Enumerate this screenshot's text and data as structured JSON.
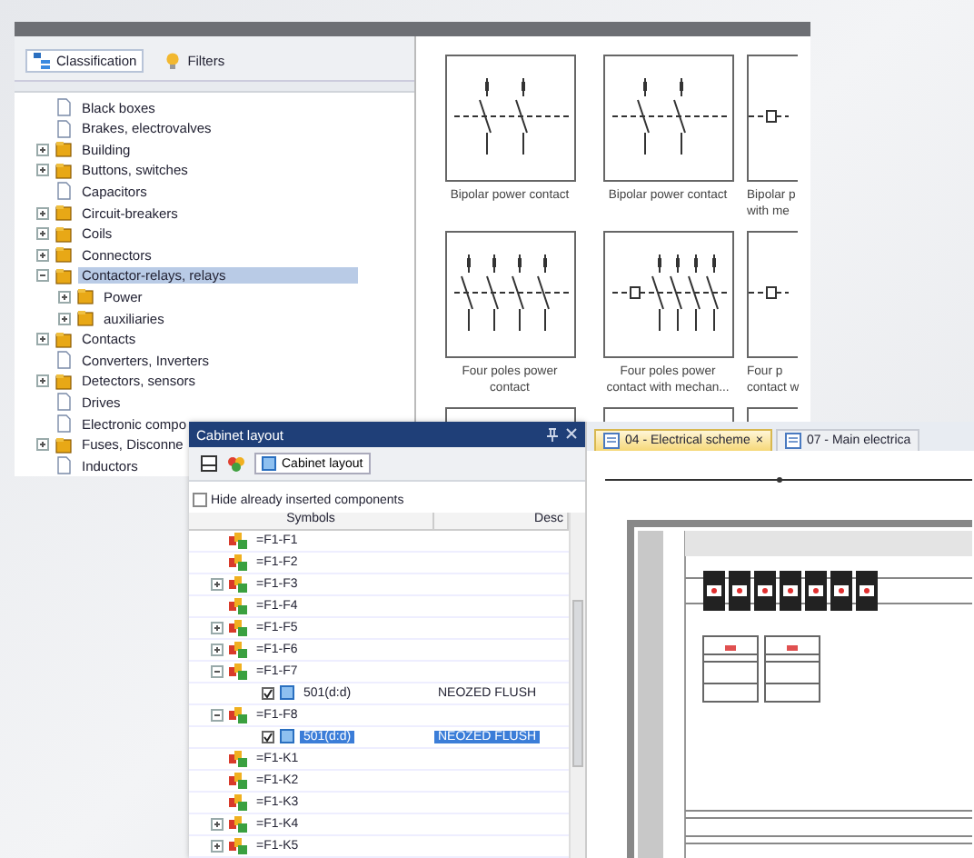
{
  "library": {
    "tabs": [
      {
        "label": "Classification",
        "selected": true
      },
      {
        "label": "Filters",
        "selected": false
      }
    ],
    "tree": [
      {
        "label": "Black boxes",
        "kind": "page",
        "expandable": false,
        "selected": false
      },
      {
        "label": "Brakes, electrovalves",
        "kind": "page",
        "expandable": false,
        "selected": false
      },
      {
        "label": "Building",
        "kind": "folder",
        "expandable": true,
        "expanded": false,
        "selected": false
      },
      {
        "label": "Buttons, switches",
        "kind": "folder",
        "expandable": true,
        "expanded": false,
        "selected": false
      },
      {
        "label": "Capacitors",
        "kind": "page",
        "expandable": false,
        "selected": false
      },
      {
        "label": "Circuit-breakers",
        "kind": "folder",
        "expandable": true,
        "expanded": false,
        "selected": false
      },
      {
        "label": "Coils",
        "kind": "folder",
        "expandable": true,
        "expanded": false,
        "selected": false
      },
      {
        "label": "Connectors",
        "kind": "folder",
        "expandable": true,
        "expanded": false,
        "selected": false
      },
      {
        "label": "Contactor-relays, relays",
        "kind": "folder",
        "expandable": true,
        "expanded": true,
        "selected": true,
        "children": [
          {
            "label": "Power",
            "kind": "folder",
            "expandable": true,
            "expanded": false,
            "selected": false
          },
          {
            "label": "auxiliaries",
            "kind": "folder",
            "expandable": true,
            "expanded": false,
            "selected": false
          }
        ]
      },
      {
        "label": "Contacts",
        "kind": "folder",
        "expandable": true,
        "expanded": false,
        "selected": false
      },
      {
        "label": "Converters, Inverters",
        "kind": "page",
        "expandable": false,
        "selected": false
      },
      {
        "label": "Detectors, sensors",
        "kind": "folder",
        "expandable": true,
        "expanded": false,
        "selected": false
      },
      {
        "label": "Drives",
        "kind": "page",
        "expandable": false,
        "selected": false
      },
      {
        "label": "Electronic compo",
        "kind": "page",
        "expandable": false,
        "selected": false
      },
      {
        "label": "Fuses, Disconne",
        "kind": "folder",
        "expandable": true,
        "expanded": false,
        "selected": false
      },
      {
        "label": "Inductors",
        "kind": "page",
        "expandable": false,
        "selected": false
      }
    ],
    "symbols": [
      {
        "kind": "two-pole",
        "lines": [
          "Bipolar power contact"
        ]
      },
      {
        "kind": "two-pole",
        "lines": [
          "Bipolar power contact"
        ]
      },
      {
        "kind": "two-pole-mech",
        "lines": [
          "Bipolar p",
          "with me"
        ]
      },
      {
        "kind": "four-pole",
        "lines": [
          "Four poles power",
          "contact"
        ]
      },
      {
        "kind": "four-pole-mech",
        "lines": [
          "Four poles power",
          "contact with mechan..."
        ]
      },
      {
        "kind": "four-pole-mech",
        "lines": [
          "Four p",
          "contact w"
        ]
      },
      {
        "kind": "blank"
      },
      {
        "kind": "blank"
      },
      {
        "kind": "blank"
      }
    ]
  },
  "cabinet": {
    "title": "Cabinet layout",
    "toolbar_button": "Cabinet layout",
    "hide_inserted": {
      "label": "Hide already inserted components",
      "checked": false
    },
    "columns": [
      "Symbols",
      "Desc"
    ],
    "rows": [
      {
        "label": "=F1-F1",
        "expandable": false,
        "selected": false
      },
      {
        "label": "=F1-F2",
        "expandable": false,
        "selected": false
      },
      {
        "label": "=F1-F3",
        "expandable": true,
        "expanded": false,
        "selected": false
      },
      {
        "label": "=F1-F4",
        "expandable": false,
        "selected": false
      },
      {
        "label": "=F1-F5",
        "expandable": true,
        "expanded": false,
        "selected": false
      },
      {
        "label": "=F1-F6",
        "expandable": true,
        "expanded": false,
        "selected": false
      },
      {
        "label": "=F1-F7",
        "expandable": true,
        "expanded": true,
        "selected": false,
        "children": [
          {
            "label": "501(d:d)",
            "desc": "NEOZED FLUSH",
            "checked": true,
            "selected": false
          }
        ]
      },
      {
        "label": "=F1-F8",
        "expandable": true,
        "expanded": true,
        "selected": false,
        "children": [
          {
            "label": "501(d:d)",
            "desc": "NEOZED FLUSH",
            "checked": true,
            "selected": true
          }
        ]
      },
      {
        "label": "=F1-K1",
        "expandable": false,
        "selected": false
      },
      {
        "label": "=F1-K2",
        "expandable": false,
        "selected": false
      },
      {
        "label": "=F1-K3",
        "expandable": false,
        "selected": false
      },
      {
        "label": "=F1-K4",
        "expandable": true,
        "expanded": false,
        "selected": false
      },
      {
        "label": "=F1-K5",
        "expandable": true,
        "expanded": false,
        "selected": false
      }
    ]
  },
  "scheme": {
    "tabs": [
      {
        "label": "04 - Electrical scheme",
        "selected": true,
        "close": "×"
      },
      {
        "label": "07 - Main electrica",
        "selected": false
      }
    ]
  }
}
